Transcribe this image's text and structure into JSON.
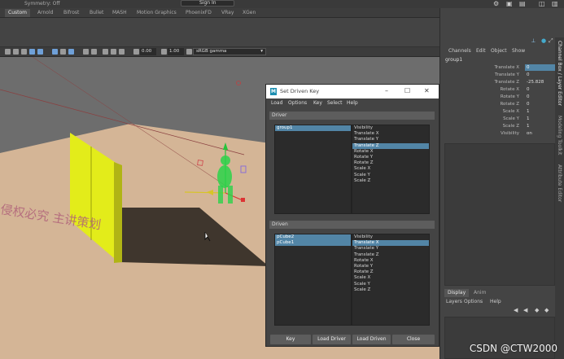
{
  "topbar": {
    "symmetry": "Symmetry: Off",
    "sign_in": "Sign In"
  },
  "shelf": {
    "tabs": [
      "Custom",
      "Arnold",
      "Bifrost",
      "Bullet",
      "MASH",
      "Motion Graphics",
      "PhoenixFD",
      "VRay",
      "XGen"
    ]
  },
  "viewport_toolbar": {
    "exposure": "0.00",
    "gamma": "1.00",
    "color_space": "sRGB gamma"
  },
  "viewport": {
    "watermark_text": "侵权必究 主讲策划"
  },
  "channel_box": {
    "menus": [
      "Channels",
      "Edit",
      "Object",
      "Show"
    ],
    "object_name": "group1",
    "channels": [
      {
        "label": "Translate X",
        "value": "0",
        "selected": true
      },
      {
        "label": "Translate Y",
        "value": "0"
      },
      {
        "label": "Translate Z",
        "value": "-25.828"
      },
      {
        "label": "Rotate X",
        "value": "0"
      },
      {
        "label": "Rotate Y",
        "value": "0"
      },
      {
        "label": "Rotate Z",
        "value": "0"
      },
      {
        "label": "Scale X",
        "value": "1"
      },
      {
        "label": "Scale Y",
        "value": "1"
      },
      {
        "label": "Scale Z",
        "value": "1"
      },
      {
        "label": "Visibility",
        "value": "on"
      }
    ],
    "side_tabs": [
      "Channel Box / Layer Editor",
      "Modeling Toolkit",
      "Attribute Editor"
    ]
  },
  "layer_editor": {
    "tabs": [
      "Display",
      "Anim"
    ],
    "menus": [
      "Layers",
      "Options",
      "Help"
    ]
  },
  "sdk_dialog": {
    "title": "Set Driven Key",
    "menus": [
      "Load",
      "Options",
      "Key",
      "Select",
      "Help"
    ],
    "driver": {
      "header": "Driver",
      "objects": [
        {
          "name": "group1",
          "selected": true
        }
      ],
      "attributes": [
        {
          "name": "Visibility"
        },
        {
          "name": "Translate X"
        },
        {
          "name": "Translate Y"
        },
        {
          "name": "Translate Z",
          "selected": true
        },
        {
          "name": "Rotate X"
        },
        {
          "name": "Rotate Y"
        },
        {
          "name": "Rotate Z"
        },
        {
          "name": "Scale X"
        },
        {
          "name": "Scale Y"
        },
        {
          "name": "Scale Z"
        }
      ]
    },
    "driven": {
      "header": "Driven",
      "objects": [
        {
          "name": "pCube2",
          "selected": true
        },
        {
          "name": "pCube1",
          "selected": true
        }
      ],
      "attributes": [
        {
          "name": "Visibility"
        },
        {
          "name": "Translate X",
          "selected": true
        },
        {
          "name": "Translate Y"
        },
        {
          "name": "Translate Z"
        },
        {
          "name": "Rotate X"
        },
        {
          "name": "Rotate Y"
        },
        {
          "name": "Rotate Z"
        },
        {
          "name": "Scale X"
        },
        {
          "name": "Scale Y"
        },
        {
          "name": "Scale Z"
        }
      ]
    },
    "buttons": [
      "Key",
      "Load Driver",
      "Load Driven",
      "Close"
    ]
  },
  "watermark": "CSDN @CTW2000"
}
